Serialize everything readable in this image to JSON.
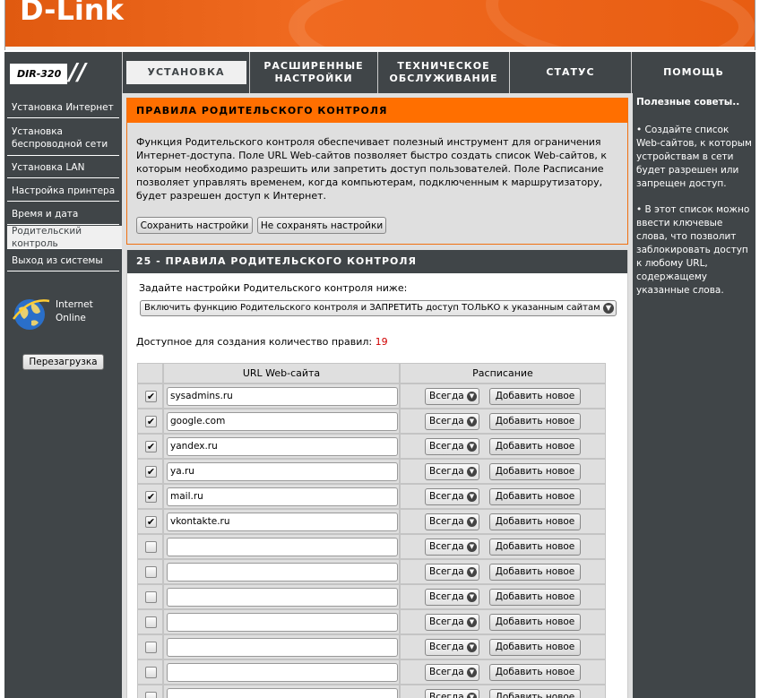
{
  "brand": {
    "logo": "D-Link",
    "model": "DIR-320"
  },
  "nav": {
    "tabs": [
      {
        "label": "УСТАНОВКА"
      },
      {
        "label": "РАСШИРЕННЫЕ НАСТРОЙКИ"
      },
      {
        "label": "ТЕХНИЧЕСКОЕ ОБСЛУЖИВАНИЕ"
      },
      {
        "label": "СТАТУС"
      },
      {
        "label": "ПОМОЩЬ"
      }
    ]
  },
  "sidebar": {
    "items": [
      {
        "label": "Установка Интернет"
      },
      {
        "label": "Установка беспроводной сети"
      },
      {
        "label": "Установка LAN"
      },
      {
        "label": "Настройка принтера"
      },
      {
        "label": "Время и дата"
      },
      {
        "label": "Родительский контроль"
      },
      {
        "label": "Выход из системы"
      }
    ],
    "status_line1": "Internet",
    "status_line2": "Online",
    "reboot_label": "Перезагрузка"
  },
  "main": {
    "section1": {
      "title": "ПРАВИЛА РОДИТЕЛЬСКОГО КОНТРОЛЯ",
      "description": "Функция Родительского контроля обеспечивает полезный инструмент для ограничения Интернет-доступа. Поле URL Web-сайтов позволяет быстро создать список Web-сайтов, к которым необходимо разрешить или запретить доступ пользователей. Поле Расписание позволяет управлять временем, когда компьютерам, подключенным к маршрутизатору, будет разрешен доступ к Интернет.",
      "save_label": "Сохранить настройки",
      "nosave_label": "Не сохранять настройки"
    },
    "section2": {
      "title": "25 - ПРАВИЛА РОДИТЕЛЬСКОГО КОНТРОЛЯ",
      "prompt": "Задайте настройки Родительского контроля ниже:",
      "mode_selected": "Включить функцию Родительского контроля и ЗАПРЕТИТЬ доступ ТОЛЬКО к указанным сайтам",
      "avail_label": "Доступное для создания количество правил:",
      "avail_count": "19",
      "table": {
        "col_url": "URL Web-сайта",
        "col_schedule": "Расписание",
        "rows": [
          {
            "checked": "✔",
            "url": "sysadmins.ru",
            "schedule": "Всегда",
            "add": "Добавить новое"
          },
          {
            "checked": "✔",
            "url": "google.com",
            "schedule": "Всегда",
            "add": "Добавить новое"
          },
          {
            "checked": "✔",
            "url": "yandex.ru",
            "schedule": "Всегда",
            "add": "Добавить новое"
          },
          {
            "checked": "✔",
            "url": "ya.ru",
            "schedule": "Всегда",
            "add": "Добавить новое"
          },
          {
            "checked": "✔",
            "url": "mail.ru",
            "schedule": "Всегда",
            "add": "Добавить новое"
          },
          {
            "checked": "✔",
            "url": "vkontakte.ru",
            "schedule": "Всегда",
            "add": "Добавить новое"
          },
          {
            "checked": "",
            "url": "",
            "schedule": "Всегда",
            "add": "Добавить новое"
          },
          {
            "checked": "",
            "url": "",
            "schedule": "Всегда",
            "add": "Добавить новое"
          },
          {
            "checked": "",
            "url": "",
            "schedule": "Всегда",
            "add": "Добавить новое"
          },
          {
            "checked": "",
            "url": "",
            "schedule": "Всегда",
            "add": "Добавить новое"
          },
          {
            "checked": "",
            "url": "",
            "schedule": "Всегда",
            "add": "Добавить новое"
          },
          {
            "checked": "",
            "url": "",
            "schedule": "Всегда",
            "add": "Добавить новое"
          },
          {
            "checked": "",
            "url": "",
            "schedule": "Всегда",
            "add": "Добавить новое"
          }
        ]
      }
    }
  },
  "hints": {
    "title": "Полезные советы..",
    "tip1": "•  Создайте список Web-сайтов, к которым устройствам в сети будет разрешен или запрещен доступ.",
    "tip2": "•  В этот список можно ввести ключевые слова, что позволит заблокировать доступ к любому URL, содержащему указанные слова."
  },
  "colors": {
    "accent": "#ff6f00",
    "panel": "#404548",
    "content": "#dfdfdf"
  }
}
